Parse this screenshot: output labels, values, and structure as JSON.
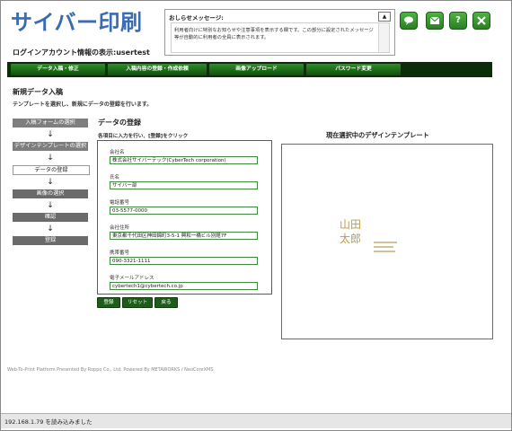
{
  "app": {
    "logo": "サイバー印刷"
  },
  "header": {
    "account_text": "ログインアカウント情報の表示:usertest",
    "notice_title": "おしらせメッセージ:",
    "notice_body": "利用者向けに特別なお知らせや注意事項を表示する欄です。この部分に設定されたメッセージ等が自動的に利用者の全員に表示されます。",
    "icons": [
      "chat-icon",
      "mail-icon",
      "help-icon",
      "close-icon"
    ]
  },
  "nav": {
    "items": [
      "データ入稿・修正",
      "入稿内容の登録・作成依頼",
      "画像アップロード",
      "パスワード変更"
    ]
  },
  "page": {
    "title": "新規データ入稿",
    "description": "テンプレートを選択し、新規にデータの登録を行います。"
  },
  "steps": [
    {
      "label": "入稿フォームの選択",
      "state": "done"
    },
    {
      "label": "デザインテンプレートの選択",
      "state": "done"
    },
    {
      "label": "データの登録",
      "state": "current"
    },
    {
      "label": "画像の選択",
      "state": "todo"
    },
    {
      "label": "確認",
      "state": "todo"
    },
    {
      "label": "登録",
      "state": "todo"
    }
  ],
  "step_arrow": "↓",
  "form": {
    "title": "データの登録",
    "instruction": "各項目に入力を行い、[登録]をクリック",
    "fields": [
      {
        "label": "会社名",
        "value": "株式会社サイバーテック(CyberTech corporation)"
      },
      {
        "label": "氏名",
        "value": "サイバー部"
      },
      {
        "label": "電話番号",
        "value": "03-5577-0000"
      },
      {
        "label": "会社住所",
        "value": "東京都千代田区神田錦町3-5-1 興和一橋ビル別館7F"
      },
      {
        "label": "携帯番号",
        "value": "090-3321-1111"
      },
      {
        "label": "電子メールアドレス",
        "value": "cybertech1@cybertech.co.jp"
      }
    ],
    "buttons": {
      "submit": "登録",
      "reset": "リセット",
      "back": "戻る"
    }
  },
  "preview": {
    "title": "現在選択中のデザインテンプレート",
    "card_text": "山田\n太郎"
  },
  "footer": {
    "credit": "Web-To-Print Platform Presented By Roppo Co., Ltd.   Powered By METAWORKS / NeoCoreXMS"
  },
  "status": {
    "text": "192.168.1.79 を読み込みました"
  },
  "colors": {
    "accent_green": "#2a7f23",
    "nav_dark": "#0b2e08",
    "logo_blue": "#3a6bb5"
  }
}
